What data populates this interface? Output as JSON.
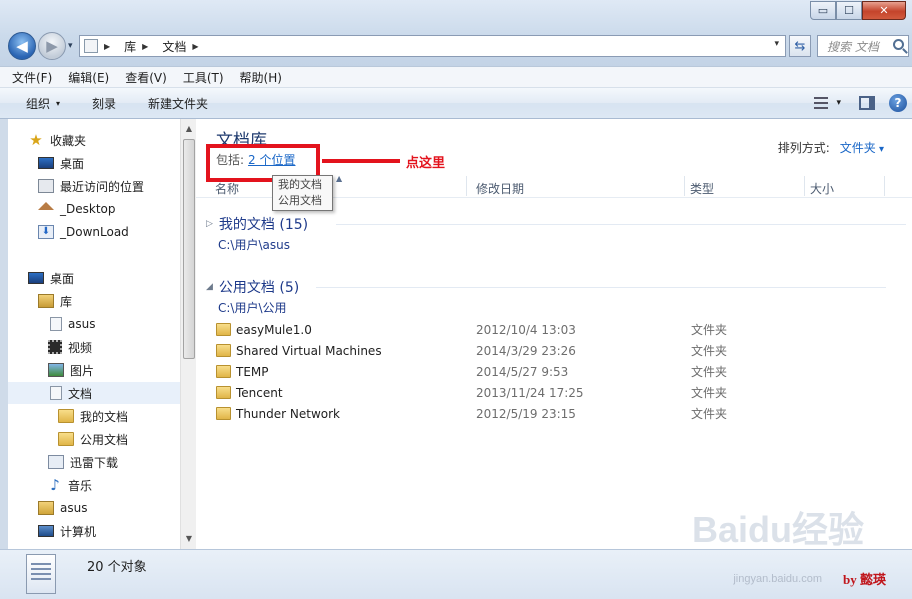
{
  "window": {
    "min_glyph": "▭",
    "max_glyph": "☐",
    "close_glyph": "✕"
  },
  "nav": {
    "back_glyph": "◀",
    "forward_glyph": "▶",
    "dropdown_glyph": "▾"
  },
  "address": {
    "crumbs": [
      "库",
      "文档"
    ],
    "sep": "▶",
    "refresh_glyph": "⇆"
  },
  "search": {
    "placeholder": "搜索 文档"
  },
  "menu": [
    "文件(F)",
    "编辑(E)",
    "查看(V)",
    "工具(T)",
    "帮助(H)"
  ],
  "toolbar": {
    "organize": "组织",
    "burn": "刻录",
    "new_folder": "新建文件夹"
  },
  "sidebar": {
    "items": [
      {
        "label": "收藏夹",
        "icon": "star-icon"
      },
      {
        "label": "桌面",
        "icon": "desktop-icon"
      },
      {
        "label": "最近访问的位置",
        "icon": "recent-places-icon"
      },
      {
        "label": "_Desktop",
        "icon": "home-icon"
      },
      {
        "label": "_DownLoad",
        "icon": "download-icon"
      },
      {
        "label": "桌面",
        "icon": "desktop-icon"
      },
      {
        "label": "库",
        "icon": "library-icon"
      },
      {
        "label": "asus",
        "icon": "document-icon"
      },
      {
        "label": "视频",
        "icon": "video-icon"
      },
      {
        "label": "图片",
        "icon": "picture-icon"
      },
      {
        "label": "文档",
        "icon": "document-icon"
      },
      {
        "label": "我的文档",
        "icon": "folder-icon"
      },
      {
        "label": "公用文档",
        "icon": "folder-icon"
      },
      {
        "label": "迅雷下载",
        "icon": "download-icon"
      },
      {
        "label": "音乐",
        "icon": "music-icon"
      },
      {
        "label": "asus",
        "icon": "user-folder-icon"
      },
      {
        "label": "计算机",
        "icon": "computer-icon"
      }
    ]
  },
  "library": {
    "title": "文档库",
    "includes_label": "包括:",
    "includes_link": "2 个位置",
    "arrange_label": "排列方式:",
    "arrange_value": "文件夹",
    "tooltip_lines": [
      "我的文档",
      "公用文档"
    ]
  },
  "annotation": {
    "label": "点这里"
  },
  "columns": [
    "名称",
    "修改日期",
    "类型",
    "大小"
  ],
  "groups": [
    {
      "title": "我的文档 (15)",
      "path": "C:\\用户\\asus",
      "expanded": false
    },
    {
      "title": "公用文档 (5)",
      "path": "C:\\用户\\公用",
      "expanded": true
    }
  ],
  "files": [
    {
      "name": "easyMule1.0",
      "date": "2012/10/4 13:03",
      "type": "文件夹"
    },
    {
      "name": "Shared Virtual Machines",
      "date": "2014/3/29 23:26",
      "type": "文件夹"
    },
    {
      "name": "TEMP",
      "date": "2014/5/27 9:53",
      "type": "文件夹"
    },
    {
      "name": "Tencent",
      "date": "2013/11/24 17:25",
      "type": "文件夹"
    },
    {
      "name": "Thunder Network",
      "date": "2012/5/19 23:15",
      "type": "文件夹"
    }
  ],
  "status": {
    "count": "20 个对象"
  },
  "watermark": {
    "main": "Baidu经验",
    "sub": "jingyan.baidu.com",
    "byline": "by 懿瑛"
  },
  "colors": {
    "accent": "#1a67c7",
    "annotation": "#e3131d"
  }
}
